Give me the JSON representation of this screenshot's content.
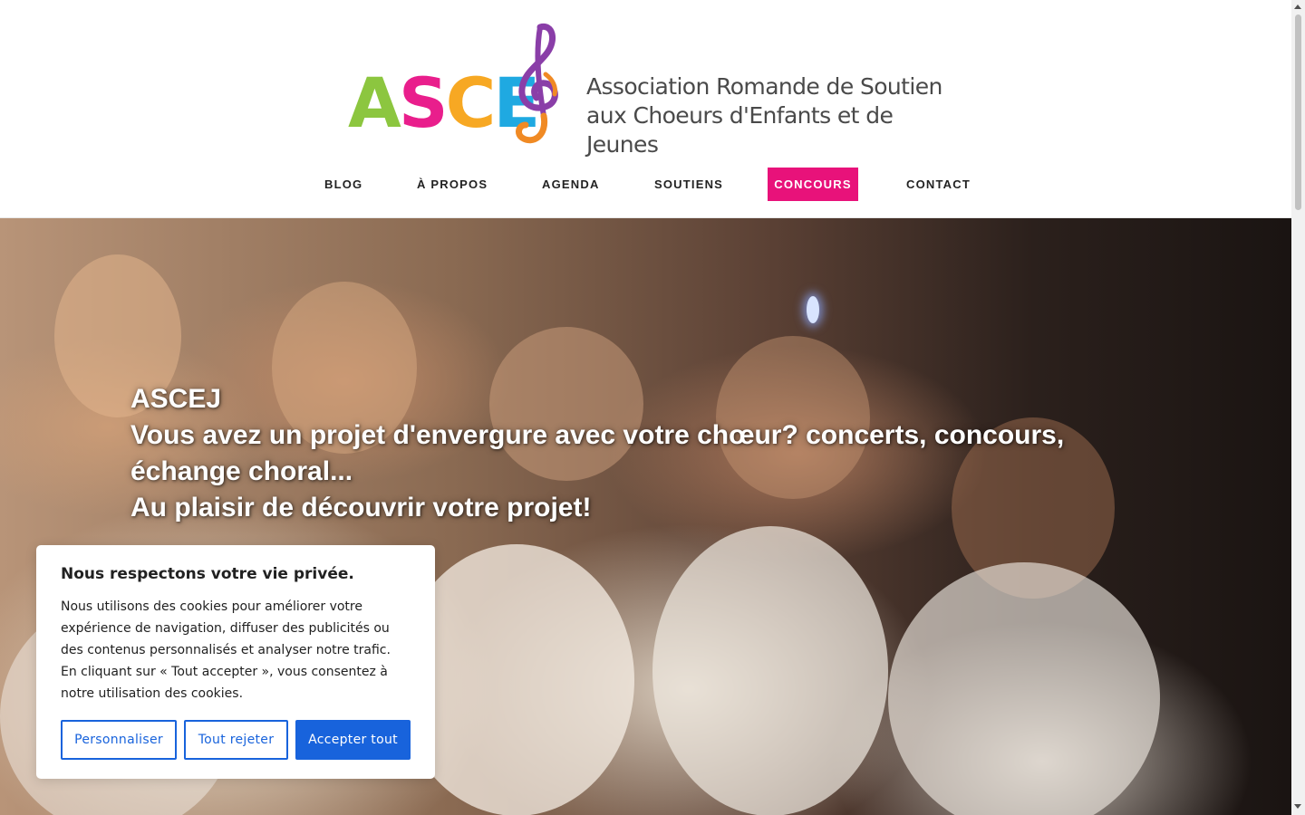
{
  "logo": {
    "letters": [
      {
        "char": "A",
        "color": "#8cc63f"
      },
      {
        "char": "S",
        "color": "#e91e8c"
      },
      {
        "char": "C",
        "color": "#f7a823"
      },
      {
        "char": "E",
        "color": "#1fa9e1"
      }
    ],
    "clef_colors": [
      "#8a3ea8",
      "#f08a24"
    ],
    "text_line1": "Association Romande de Soutien",
    "text_line2": "aux Choeurs d'Enfants et de Jeunes"
  },
  "nav": {
    "items": [
      {
        "label": "BLOG",
        "active": false
      },
      {
        "label": "À PROPOS",
        "active": false
      },
      {
        "label": "AGENDA",
        "active": false
      },
      {
        "label": "SOUTIENS",
        "active": false
      },
      {
        "label": "CONCOURS",
        "active": true
      },
      {
        "label": "CONTACT",
        "active": false
      }
    ],
    "active_color": "#e8127a"
  },
  "hero": {
    "line1": "ASCEJ",
    "line2": "Vous avez un projet d'envergure avec votre chœur? concerts, concours,",
    "line3": "échange choral...",
    "line4": "Au plaisir de découvrir votre projet!"
  },
  "cookie": {
    "title": "Nous respectons votre vie privée.",
    "body": "Nous utilisons des cookies pour améliorer votre expérience de navigation, diffuser des publicités ou des contenus personnalisés et analyser notre trafic. En cliquant sur « Tout accepter », vous consentez à notre utilisation des cookies.",
    "customize_label": "Personnaliser",
    "reject_label": "Tout rejeter",
    "accept_label": "Accepter tout",
    "button_color": "#1863dc"
  }
}
